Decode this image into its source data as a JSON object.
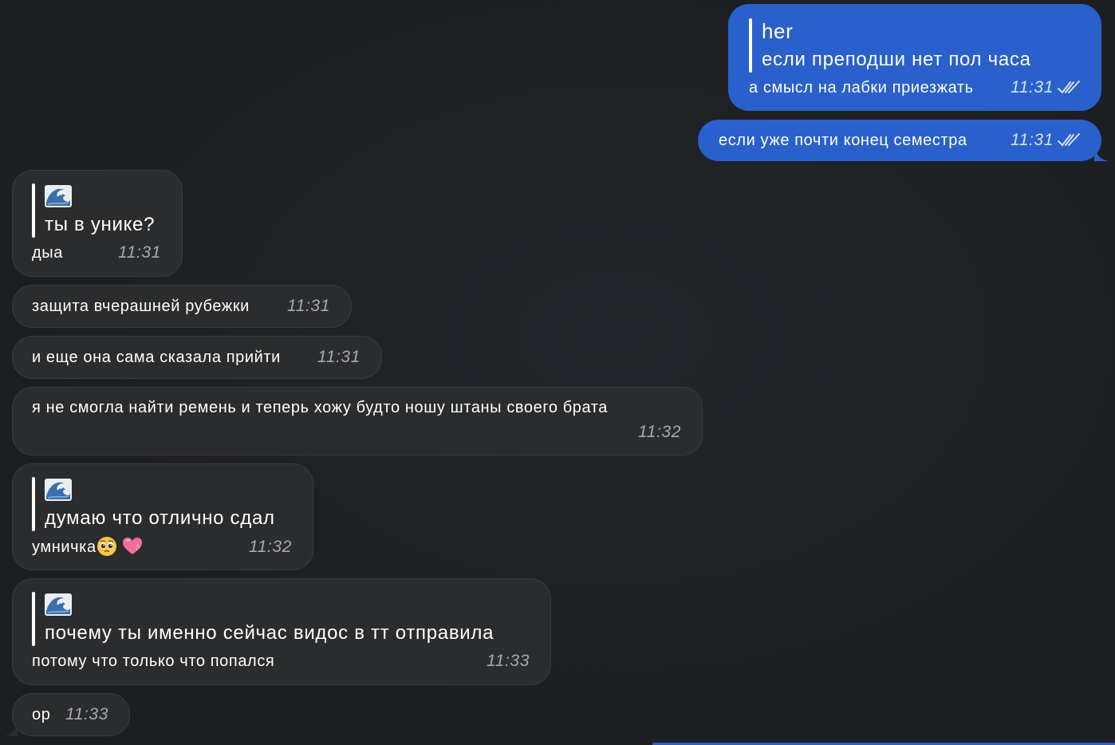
{
  "messages": {
    "m1": {
      "reply_title": "her",
      "reply_text": "если преподши нет пол часа",
      "text": "а смысл на лабки приезжать",
      "time": "11:31"
    },
    "m2": {
      "text": "если уже почти конец семестра",
      "time": "11:31"
    },
    "m3": {
      "reply_icon": "water-wave-emoji",
      "reply_text": "ты в унике?",
      "text": "дыа",
      "time": "11:31"
    },
    "m4": {
      "text": "защита вчерашней рубежки",
      "time": "11:31"
    },
    "m5": {
      "text": "и еще она сама сказала прийти",
      "time": "11:31"
    },
    "m6": {
      "text": "я не смогла найти ремень и теперь хожу будто ношу штаны своего брата",
      "time": "11:32"
    },
    "m7": {
      "reply_icon": "water-wave-emoji",
      "reply_text": "думаю что отлично сдал",
      "text": "умничка",
      "emojis": [
        "pleading-face-emoji",
        "pink-heart-emoji"
      ],
      "time": "11:32"
    },
    "m8": {
      "reply_icon": "water-wave-emoji",
      "reply_text": "почему ты именно сейчас видос в тт отправила",
      "text": "потому что только что попался",
      "time": "11:33"
    },
    "m9": {
      "text": "ор",
      "time": "11:33"
    }
  },
  "colors": {
    "background": "#1e2023",
    "incoming_bubble": "#2b2c2e",
    "outgoing_bubble": "#2a60cc",
    "time_incoming": "#a8a9ad",
    "time_outgoing": "#d7e2f7"
  }
}
